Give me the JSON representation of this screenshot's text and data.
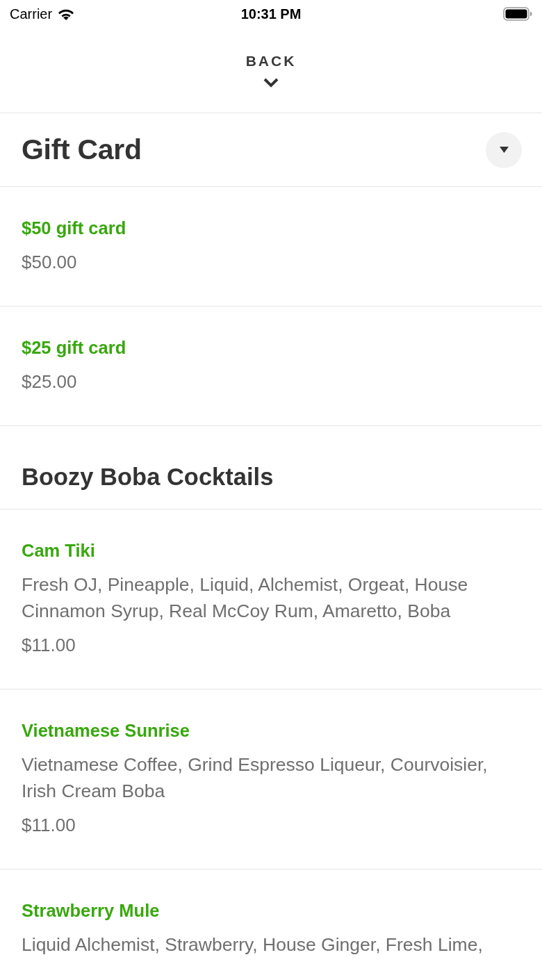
{
  "status_bar": {
    "carrier": "Carrier",
    "time": "10:31 PM"
  },
  "header": {
    "back_label": "BACK"
  },
  "sections": [
    {
      "kind": "picker",
      "title": "Gift Card",
      "items": [
        {
          "name": "$50 gift card",
          "price": "$50.00"
        },
        {
          "name": "$25 gift card",
          "price": "$25.00"
        }
      ]
    },
    {
      "kind": "heading",
      "title": "Boozy Boba Cocktails",
      "items": [
        {
          "name": "Cam Tiki",
          "description": "Fresh OJ, Pineapple, Liquid, Alchemist, Orgeat, House Cinnamon Syrup, Real McCoy Rum, Amaretto, Boba",
          "price": "$11.00"
        },
        {
          "name": "Vietnamese Sunrise",
          "description": "Vietnamese Coffee, Grind Espresso Liqueur, Courvoisier, Irish Cream Boba",
          "price": "$11.00"
        },
        {
          "name": "Strawberry Mule",
          "description": "Liquid Alchemist, Strawberry, House Ginger, Fresh Lime,"
        }
      ]
    }
  ]
}
